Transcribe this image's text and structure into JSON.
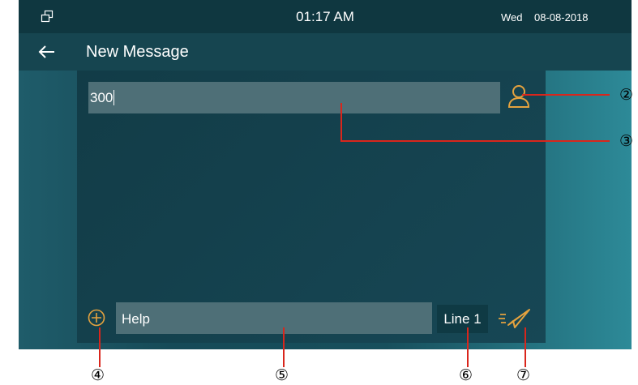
{
  "status_bar": {
    "time": "01:17 AM",
    "day": "Wed",
    "date": "08-08-2018"
  },
  "header": {
    "title": "New Message"
  },
  "compose": {
    "recipient_value": "300",
    "message_placeholder": "Help",
    "line_label": "Line 1"
  },
  "callouts": [
    "②",
    "③",
    "④",
    "⑤",
    "⑥",
    "⑦"
  ],
  "icons": {
    "status": "windows-icon",
    "back": "back-arrow-icon",
    "contact": "contact-icon",
    "add": "add-icon",
    "send": "send-icon"
  },
  "colors": {
    "accent": "#e4a23f",
    "callout_line": "#d9261c",
    "status_bar_bg": "#0f3740",
    "input_bg": "#4e6f77"
  }
}
